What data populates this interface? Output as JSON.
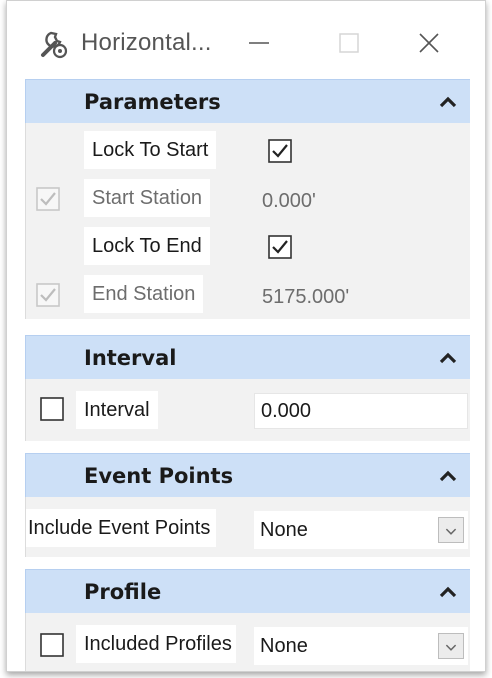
{
  "window": {
    "title": "Horizontal...",
    "icon": "wrench-gear-icon"
  },
  "sections": {
    "parameters": {
      "title": "Parameters",
      "lock_to_start": {
        "label": "Lock To Start",
        "checked": true
      },
      "start_station": {
        "label": "Start Station",
        "value": "0.000'",
        "checked": true,
        "enabled": false
      },
      "lock_to_end": {
        "label": "Lock To End",
        "checked": true
      },
      "end_station": {
        "label": "End Station",
        "value": "5175.000'",
        "checked": true,
        "enabled": false
      }
    },
    "interval": {
      "title": "Interval",
      "label": "Interval",
      "value": "0.000",
      "checked": false
    },
    "event_points": {
      "title": "Event Points",
      "label": "Include Event Points",
      "selected": "None"
    },
    "profile": {
      "title": "Profile",
      "label": "Included Profiles",
      "selected": "None",
      "checked": false
    }
  },
  "colors": {
    "header_bg": "#cde0f7",
    "body_bg": "#f2f2f2",
    "disabled_text": "#6d6d6d"
  }
}
